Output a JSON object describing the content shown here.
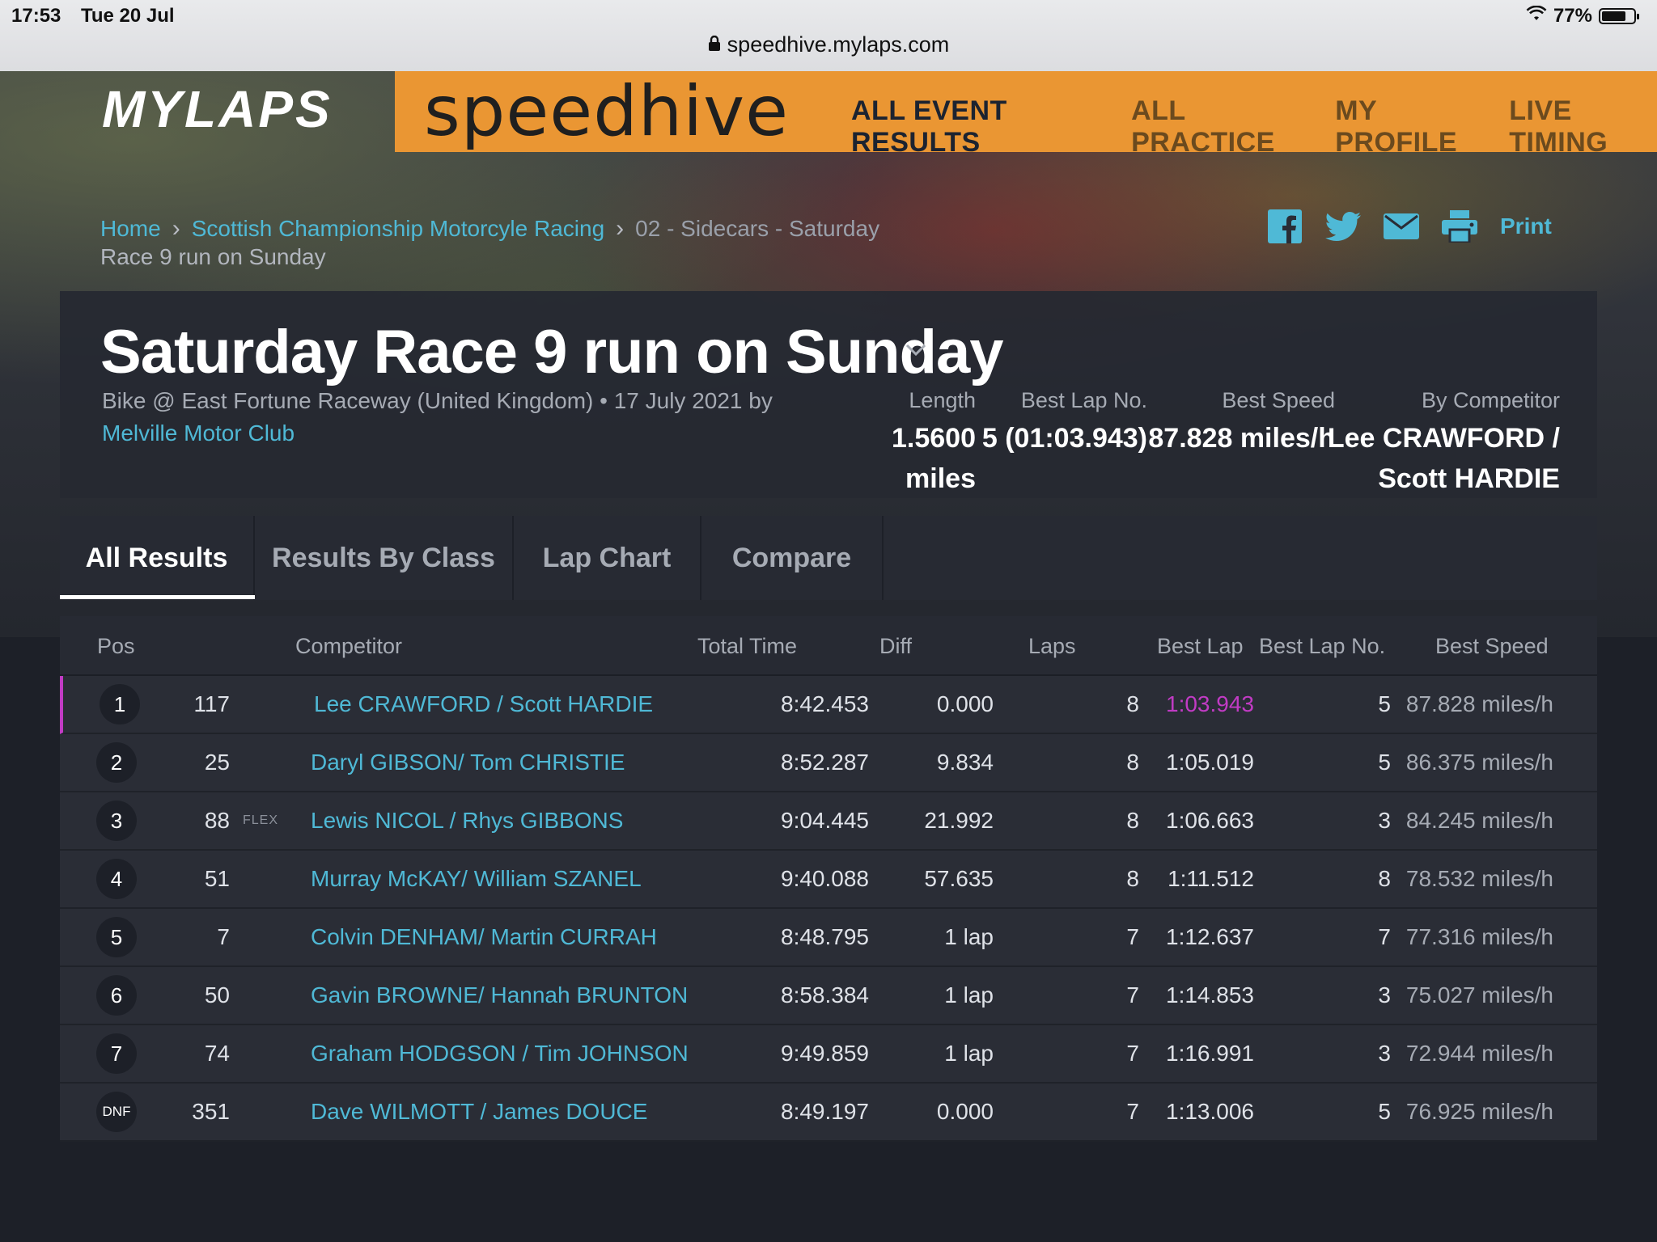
{
  "status_bar": {
    "time": "17:53",
    "date": "Tue 20 Jul",
    "battery": "77%",
    "battery_level": 0.77,
    "url": "speedhive.mylaps.com"
  },
  "header": {
    "brand_mylaps": "MYLAPS",
    "brand_speedhive": "speedhive",
    "nav": [
      "ALL EVENT RESULTS",
      "ALL PRACTICE",
      "MY PROFILE",
      "LIVE TIMING"
    ],
    "colors": {
      "accent_orange": "#ea9633",
      "link_blue": "#4fb9d6",
      "best_lap_purple": "#c13bc4"
    }
  },
  "breadcrumb": {
    "home": "Home",
    "series": "Scottish Championship Motorcyle Racing",
    "session": "02 - Sidecars - Saturday",
    "current": "Race 9 run on Sunday"
  },
  "share": {
    "icons": [
      "facebook-icon",
      "twitter-icon",
      "mail-icon",
      "printer-icon"
    ],
    "print_label": "Print"
  },
  "event": {
    "title": "Saturday Race 9 run on Sunday",
    "subtitle": "Bike @ East Fortune Raceway (United Kingdom) • 17 July 2021 by",
    "organizer": "Melville Motor Club",
    "stats": [
      {
        "label": "Length",
        "value_line1": "1.5600",
        "value_line2": "miles"
      },
      {
        "label": "Best Lap No.",
        "value_line1": "5 (01:03.943)",
        "value_line2": ""
      },
      {
        "label": "Best Speed",
        "value_line1": "87.828 miles/h",
        "value_line2": ""
      },
      {
        "label": "By Competitor",
        "value_line1": "Lee CRAWFORD /",
        "value_line2": "Scott HARDIE"
      }
    ]
  },
  "tabs": [
    "All Results",
    "Results By Class",
    "Lap Chart",
    "Compare"
  ],
  "table": {
    "headers": [
      "Pos",
      "Competitor",
      "Total Time",
      "Diff",
      "Laps",
      "Best Lap",
      "Best Lap No.",
      "Best Speed"
    ],
    "rows": [
      {
        "pos": "1",
        "number": "117",
        "tag": "",
        "competitor": "Lee CRAWFORD / Scott HARDIE",
        "total_time": "8:42.453",
        "diff": "0.000",
        "laps": "8",
        "best_lap": "1:03.943",
        "best_lap_no": "5",
        "best_speed": "87.828 miles/h"
      },
      {
        "pos": "2",
        "number": "25",
        "tag": "",
        "competitor": "Daryl GIBSON/ Tom CHRISTIE",
        "total_time": "8:52.287",
        "diff": "9.834",
        "laps": "8",
        "best_lap": "1:05.019",
        "best_lap_no": "5",
        "best_speed": "86.375 miles/h"
      },
      {
        "pos": "3",
        "number": "88",
        "tag": "FLEX",
        "competitor": "Lewis NICOL / Rhys GIBBONS",
        "total_time": "9:04.445",
        "diff": "21.992",
        "laps": "8",
        "best_lap": "1:06.663",
        "best_lap_no": "3",
        "best_speed": "84.245 miles/h"
      },
      {
        "pos": "4",
        "number": "51",
        "tag": "",
        "competitor": "Murray McKAY/ William SZANEL",
        "total_time": "9:40.088",
        "diff": "57.635",
        "laps": "8",
        "best_lap": "1:11.512",
        "best_lap_no": "8",
        "best_speed": "78.532 miles/h"
      },
      {
        "pos": "5",
        "number": "7",
        "tag": "",
        "competitor": "Colvin DENHAM/ Martin CURRAH",
        "total_time": "8:48.795",
        "diff": "1 lap",
        "laps": "7",
        "best_lap": "1:12.637",
        "best_lap_no": "7",
        "best_speed": "77.316 miles/h"
      },
      {
        "pos": "6",
        "number": "50",
        "tag": "",
        "competitor": "Gavin BROWNE/ Hannah BRUNTON",
        "total_time": "8:58.384",
        "diff": "1 lap",
        "laps": "7",
        "best_lap": "1:14.853",
        "best_lap_no": "3",
        "best_speed": "75.027 miles/h"
      },
      {
        "pos": "7",
        "number": "74",
        "tag": "",
        "competitor": "Graham HODGSON / Tim JOHNSON",
        "total_time": "9:49.859",
        "diff": "1 lap",
        "laps": "7",
        "best_lap": "1:16.991",
        "best_lap_no": "3",
        "best_speed": "72.944 miles/h"
      },
      {
        "pos": "DNF",
        "number": "351",
        "tag": "",
        "competitor": "Dave WILMOTT / James DOUCE",
        "total_time": "8:49.197",
        "diff": "0.000",
        "laps": "7",
        "best_lap": "1:13.006",
        "best_lap_no": "5",
        "best_speed": "76.925 miles/h"
      }
    ]
  }
}
